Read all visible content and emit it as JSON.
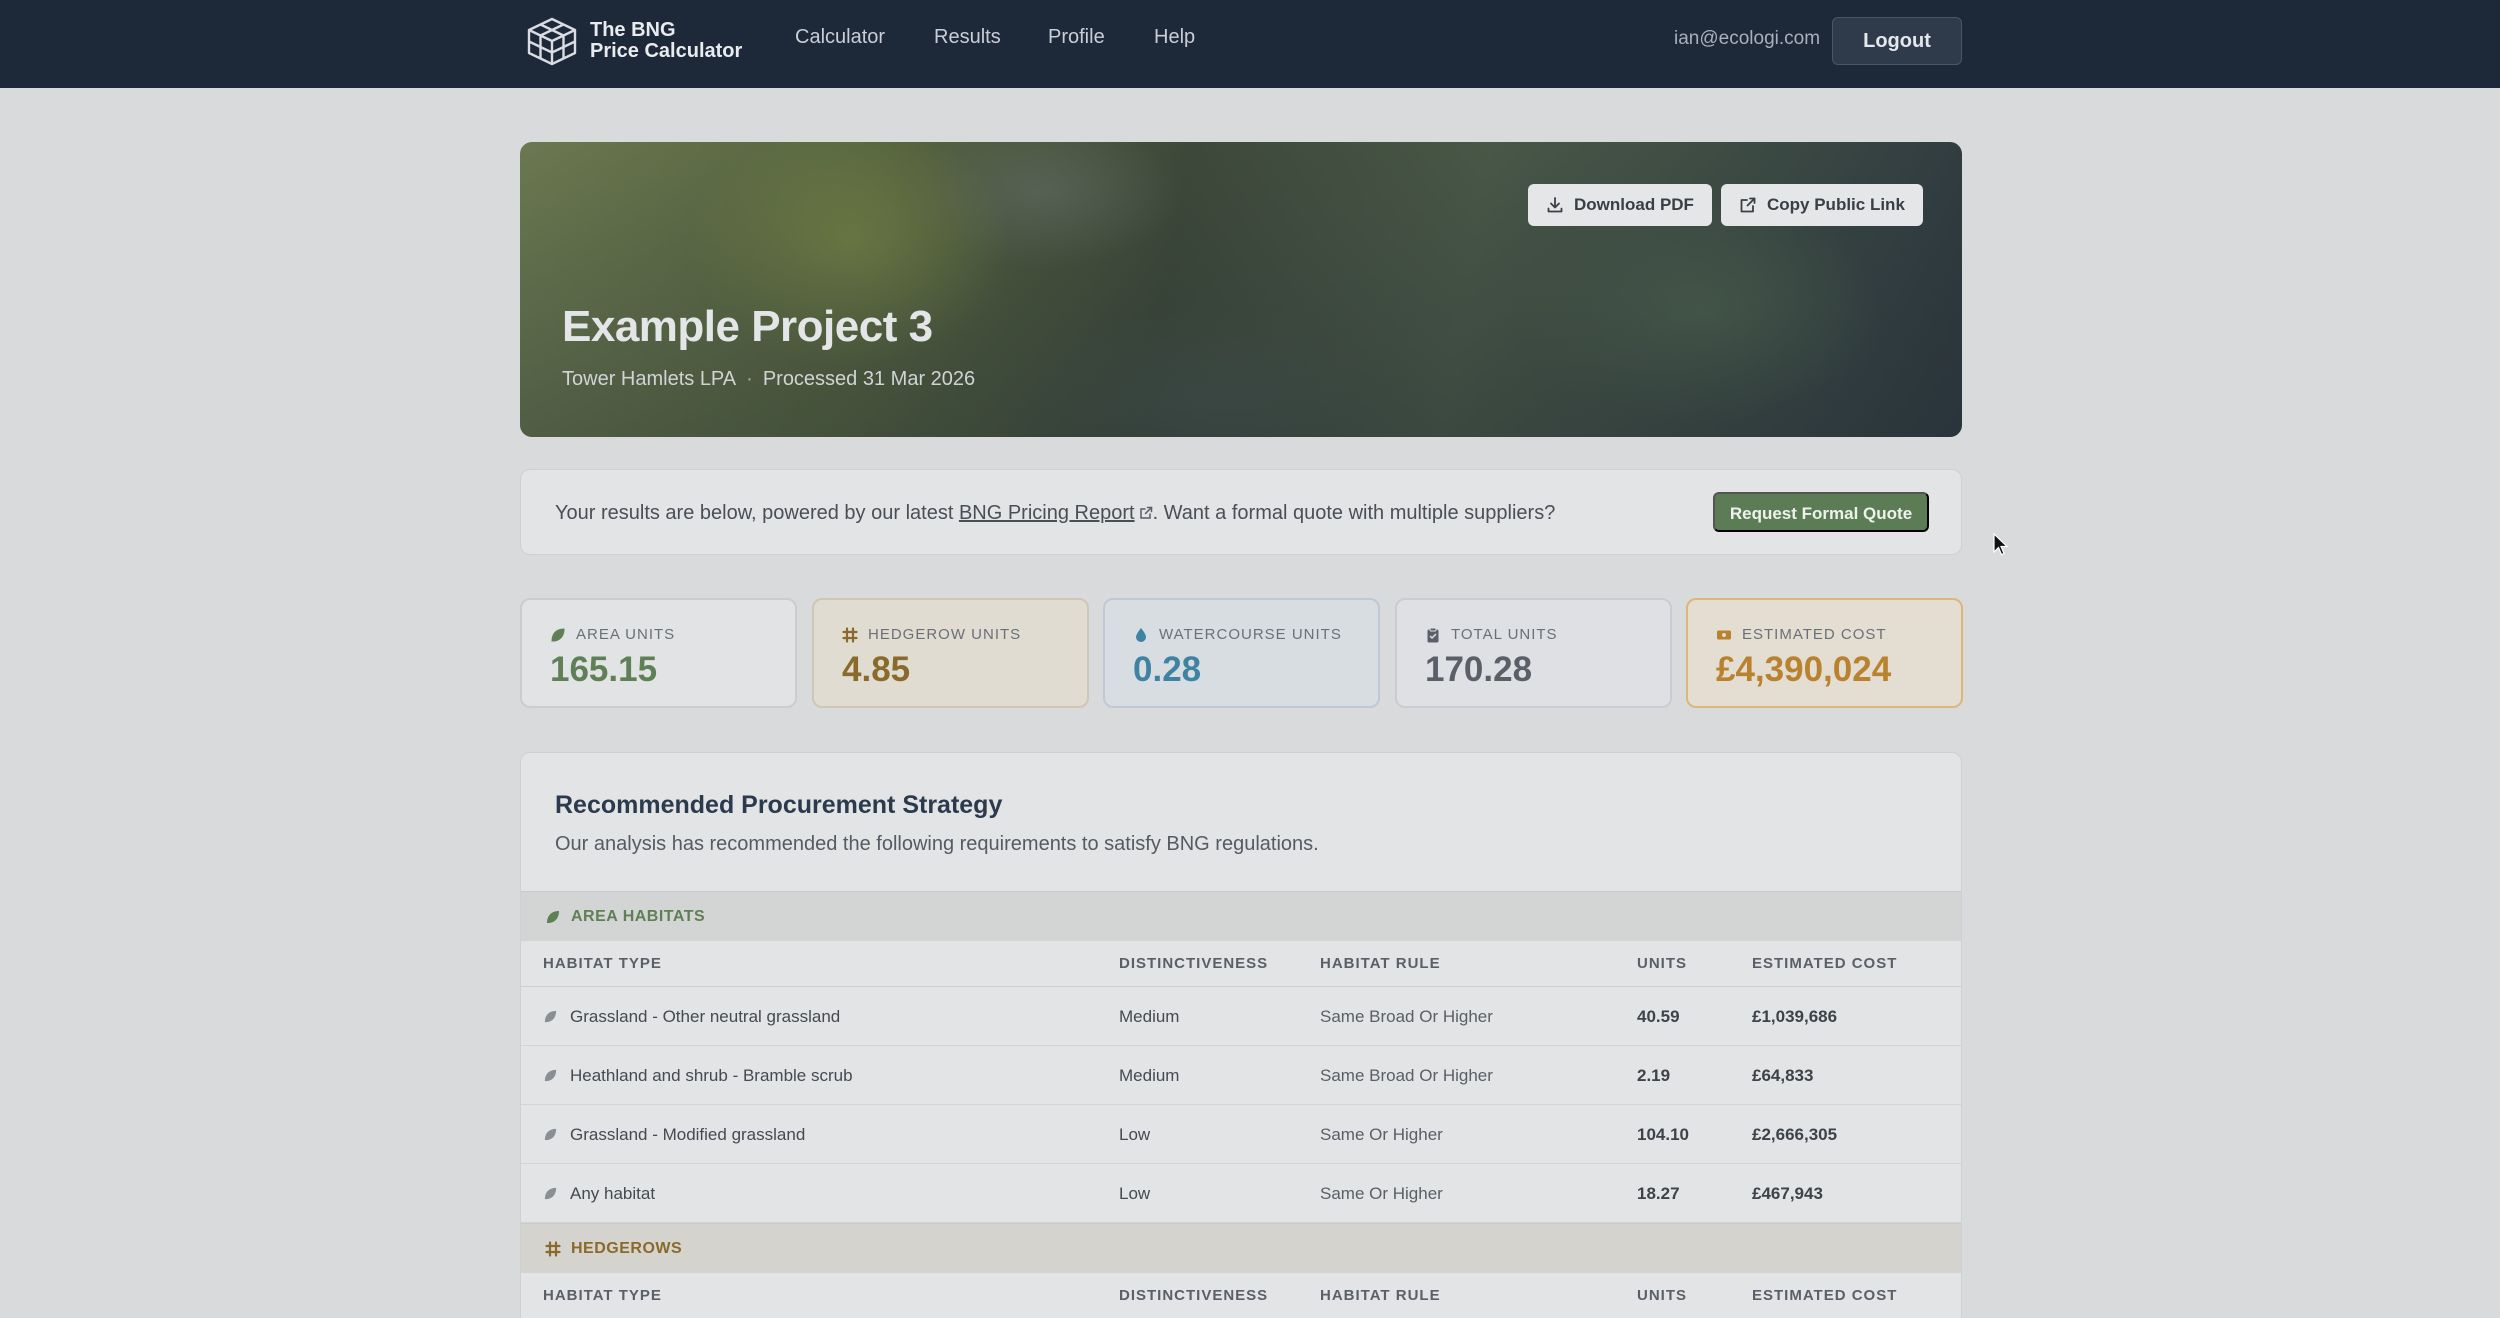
{
  "nav": {
    "logo_line1": "The BNG",
    "logo_line2": "Price Calculator",
    "links": [
      "Calculator",
      "Results",
      "Profile",
      "Help"
    ],
    "email": "ian@ecologi.com",
    "logout": "Logout"
  },
  "hero": {
    "title": "Example Project 3",
    "lpa": "Tower Hamlets LPA",
    "separator": "·",
    "processed": "Processed 31 Mar 2026",
    "download_pdf": "Download PDF",
    "copy_link": "Copy Public Link"
  },
  "info": {
    "text_before": "Your results are below, powered by our latest ",
    "link": "BNG Pricing Report",
    "text_after": ". Want a formal quote with multiple suppliers?",
    "quote_button": "Request Formal Quote"
  },
  "stats": [
    {
      "label": "AREA UNITS",
      "value": "165.15",
      "icon": "leaf-icon",
      "color": "#5f7f56"
    },
    {
      "label": "HEDGEROW UNITS",
      "value": "4.85",
      "icon": "hedgerow-icon",
      "color": "#8a6a2a"
    },
    {
      "label": "WATERCOURSE UNITS",
      "value": "0.28",
      "icon": "water-drop-icon",
      "color": "#3f83a3"
    },
    {
      "label": "TOTAL UNITS",
      "value": "170.28",
      "icon": "clipboard-icon",
      "color": "#5b6068"
    },
    {
      "label": "ESTIMATED COST",
      "value": "£4,390,024",
      "icon": "money-icon",
      "color": "#b9822e"
    }
  ],
  "strategy": {
    "title": "Recommended Procurement Strategy",
    "description": "Our analysis has recommended the following requirements to satisfy BNG regulations.",
    "columns": [
      "HABITAT TYPE",
      "DISTINCTIVENESS",
      "HABITAT RULE",
      "UNITS",
      "ESTIMATED COST"
    ],
    "area_section": "AREA HABITATS",
    "area_rows": [
      {
        "habitat": "Grassland - Other neutral grassland",
        "distinctiveness": "Medium",
        "rule": "Same Broad Or Higher",
        "units": "40.59",
        "cost": "£1,039,686"
      },
      {
        "habitat": "Heathland and shrub - Bramble scrub",
        "distinctiveness": "Medium",
        "rule": "Same Broad Or Higher",
        "units": "2.19",
        "cost": "£64,833"
      },
      {
        "habitat": "Grassland - Modified grassland",
        "distinctiveness": "Low",
        "rule": "Same Or Higher",
        "units": "104.10",
        "cost": "£2,666,305"
      },
      {
        "habitat": "Any habitat",
        "distinctiveness": "Low",
        "rule": "Same Or Higher",
        "units": "18.27",
        "cost": "£467,943"
      }
    ],
    "hedgerow_section": "HEDGEROWS"
  },
  "colors": {
    "nav_bg": "#1d2838",
    "area_green": "#5f7f56",
    "hedgerow_brown": "#8a6a2a",
    "quote_button": "#5c7c55"
  }
}
